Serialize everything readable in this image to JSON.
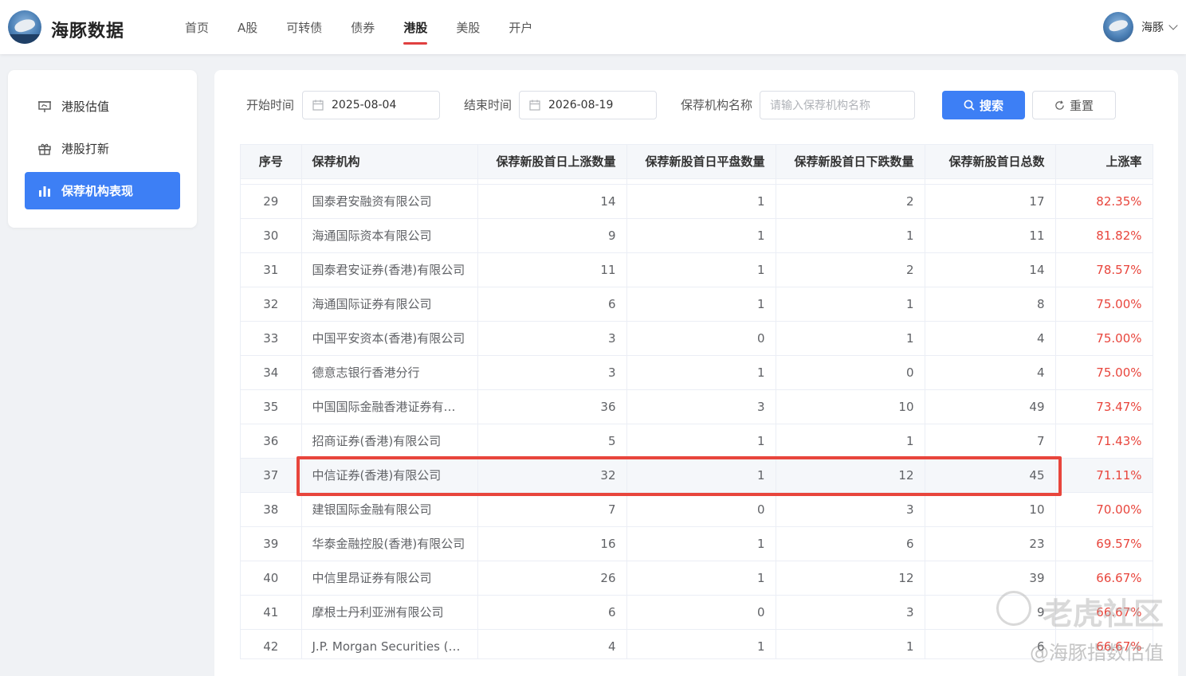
{
  "brand": {
    "name": "海豚数据"
  },
  "nav": {
    "items": [
      {
        "label": "首页",
        "active": false
      },
      {
        "label": "A股",
        "active": false
      },
      {
        "label": "可转债",
        "active": false
      },
      {
        "label": "债券",
        "active": false
      },
      {
        "label": "港股",
        "active": true
      },
      {
        "label": "美股",
        "active": false
      },
      {
        "label": "开户",
        "active": false
      }
    ]
  },
  "user": {
    "name": "海豚"
  },
  "sidebar": {
    "items": [
      {
        "label": "港股估值",
        "icon": "presentation-icon",
        "active": false
      },
      {
        "label": "港股打新",
        "icon": "gift-icon",
        "active": false
      },
      {
        "label": "保荐机构表现",
        "icon": "bar-chart-icon",
        "active": true
      }
    ]
  },
  "filters": {
    "start_label": "开始时间",
    "start_value": "2025-08-04",
    "end_label": "结束时间",
    "end_value": "2026-08-19",
    "sponsor_label": "保荐机构名称",
    "sponsor_placeholder": "请输入保荐机构名称",
    "search_label": "搜索",
    "reset_label": "重置"
  },
  "table": {
    "columns": [
      "序号",
      "保荐机构",
      "保荐新股首日上涨数量",
      "保荐新股首日平盘数量",
      "保荐新股首日下跌数量",
      "保荐新股首日总数",
      "上涨率"
    ],
    "rows": [
      [
        "29",
        "国泰君安融资有限公司",
        "14",
        "1",
        "2",
        "17",
        "82.35%"
      ],
      [
        "30",
        "海通国际资本有限公司",
        "9",
        "1",
        "1",
        "11",
        "81.82%"
      ],
      [
        "31",
        "国泰君安证券(香港)有限公司",
        "11",
        "1",
        "2",
        "14",
        "78.57%"
      ],
      [
        "32",
        "海通国际证券有限公司",
        "6",
        "1",
        "1",
        "8",
        "75.00%"
      ],
      [
        "33",
        "中国平安资本(香港)有限公司",
        "3",
        "0",
        "1",
        "4",
        "75.00%"
      ],
      [
        "34",
        "德意志银行香港分行",
        "3",
        "1",
        "0",
        "4",
        "75.00%"
      ],
      [
        "35",
        "中国国际金融香港证券有…",
        "36",
        "3",
        "10",
        "49",
        "73.47%"
      ],
      [
        "36",
        "招商证券(香港)有限公司",
        "5",
        "1",
        "1",
        "7",
        "71.43%"
      ],
      [
        "37",
        "中信证券(香港)有限公司",
        "32",
        "1",
        "12",
        "45",
        "71.11%"
      ],
      [
        "38",
        "建银国际金融有限公司",
        "7",
        "0",
        "3",
        "10",
        "70.00%"
      ],
      [
        "39",
        "华泰金融控股(香港)有限公司",
        "16",
        "1",
        "6",
        "23",
        "69.57%"
      ],
      [
        "40",
        "中信里昂证券有限公司",
        "26",
        "1",
        "12",
        "39",
        "66.67%"
      ],
      [
        "41",
        "摩根士丹利亚洲有限公司",
        "6",
        "0",
        "3",
        "9",
        "66.67%"
      ],
      [
        "42",
        "J.P. Morgan Securities (As…",
        "4",
        "1",
        "1",
        "6",
        "66.67%"
      ]
    ]
  },
  "watermark": {
    "line1": "老虎社区",
    "line2": "@海豚指数估值"
  },
  "colors": {
    "accent": "#3d7ff5",
    "rate": "#e8453c",
    "highlight": "#e8453c",
    "nav_underline": "#e04040"
  }
}
